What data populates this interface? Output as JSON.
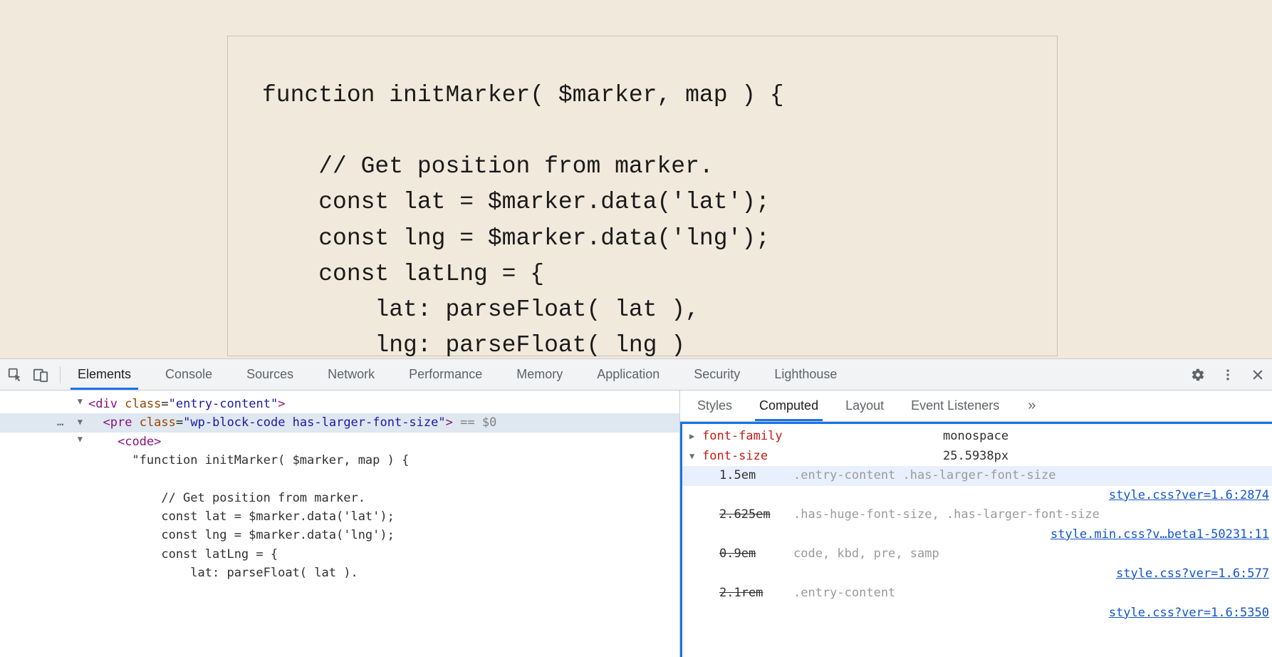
{
  "page": {
    "code_sample": "function initMarker( $marker, map ) {\n\n    // Get position from marker.\n    const lat = $marker.data('lat');\n    const lng = $marker.data('lng');\n    const latLng = {\n        lat: parseFloat( lat ),\n        lng: parseFloat( lng )"
  },
  "devtools": {
    "tabs": [
      "Elements",
      "Console",
      "Sources",
      "Network",
      "Performance",
      "Memory",
      "Application",
      "Security",
      "Lighthouse"
    ],
    "active_tab": "Elements",
    "dom": {
      "row1": {
        "tag": "div",
        "attr": "class",
        "val": "entry-content"
      },
      "row2": {
        "tag": "pre",
        "attr": "class",
        "val": "wp-block-code has-larger-font-size",
        "eq": " == $0"
      },
      "row3": {
        "tag": "code"
      },
      "text_lines": [
        "\"function initMarker( $marker, map ) {",
        "",
        "    // Get position from marker.",
        "    const lat = $marker.data('lat');",
        "    const lng = $marker.data('lng');",
        "    const latLng = {",
        "        lat: parseFloat( lat )."
      ],
      "gutter_dots": "…"
    },
    "styles_tabs": [
      "Styles",
      "Computed",
      "Layout",
      "Event Listeners"
    ],
    "styles_active": "Computed",
    "computed": {
      "font_family": {
        "name": "font-family",
        "value": "monospace"
      },
      "font_size": {
        "name": "font-size",
        "value": "25.5938px"
      },
      "traces": [
        {
          "val": "1.5em",
          "strike": false,
          "sel": ".entry-content .has-larger-font-size",
          "src": "style.css?ver=1.6:2874",
          "hl": true
        },
        {
          "val": "2.625em",
          "strike": true,
          "sel": ".has-huge-font-size, .has-larger-font-size",
          "src": "style.min.css?v…beta1-50231:11",
          "hl": false
        },
        {
          "val": "0.9em",
          "strike": true,
          "sel": "code, kbd, pre, samp",
          "src": "style.css?ver=1.6:577",
          "hl": false
        },
        {
          "val": "2.1rem",
          "strike": true,
          "sel": ".entry-content",
          "src": "style.css?ver=1.6:5350",
          "hl": false
        }
      ]
    }
  }
}
